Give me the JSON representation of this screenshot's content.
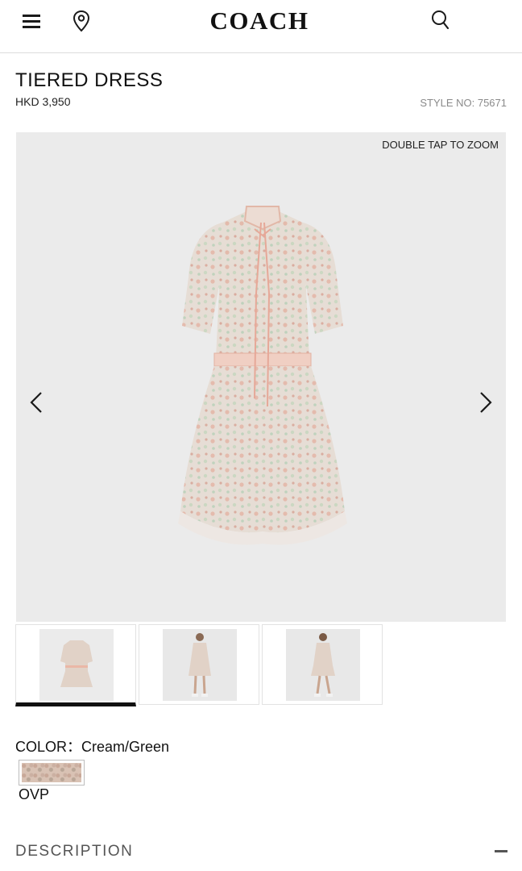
{
  "header": {
    "menu_icon": "hamburger-menu-icon",
    "location_icon": "location-pin-icon",
    "logo": "COACH",
    "search_icon": "search-icon"
  },
  "product": {
    "title": "TIERED DRESS",
    "price": "HKD 3,950",
    "style_no": "STYLE NO: 75671"
  },
  "gallery": {
    "zoom_hint": "DOUBLE TAP TO ZOOM",
    "prev_icon": "chevron-left-icon",
    "next_icon": "chevron-right-icon",
    "thumbnails": [
      {
        "label": "dress flat view",
        "active": true
      },
      {
        "label": "model front view",
        "active": false
      },
      {
        "label": "model side view",
        "active": false
      }
    ]
  },
  "color": {
    "label": "COLOR：Cream/Green",
    "swatch_label": "OVP",
    "swatch_color": "#d9c2b4"
  },
  "description": {
    "label": "DESCRIPTION",
    "toggle_icon": "minus-icon"
  },
  "colors": {
    "text": "#111111",
    "muted": "#8a8a8a",
    "image_bg": "#ebebeb"
  }
}
